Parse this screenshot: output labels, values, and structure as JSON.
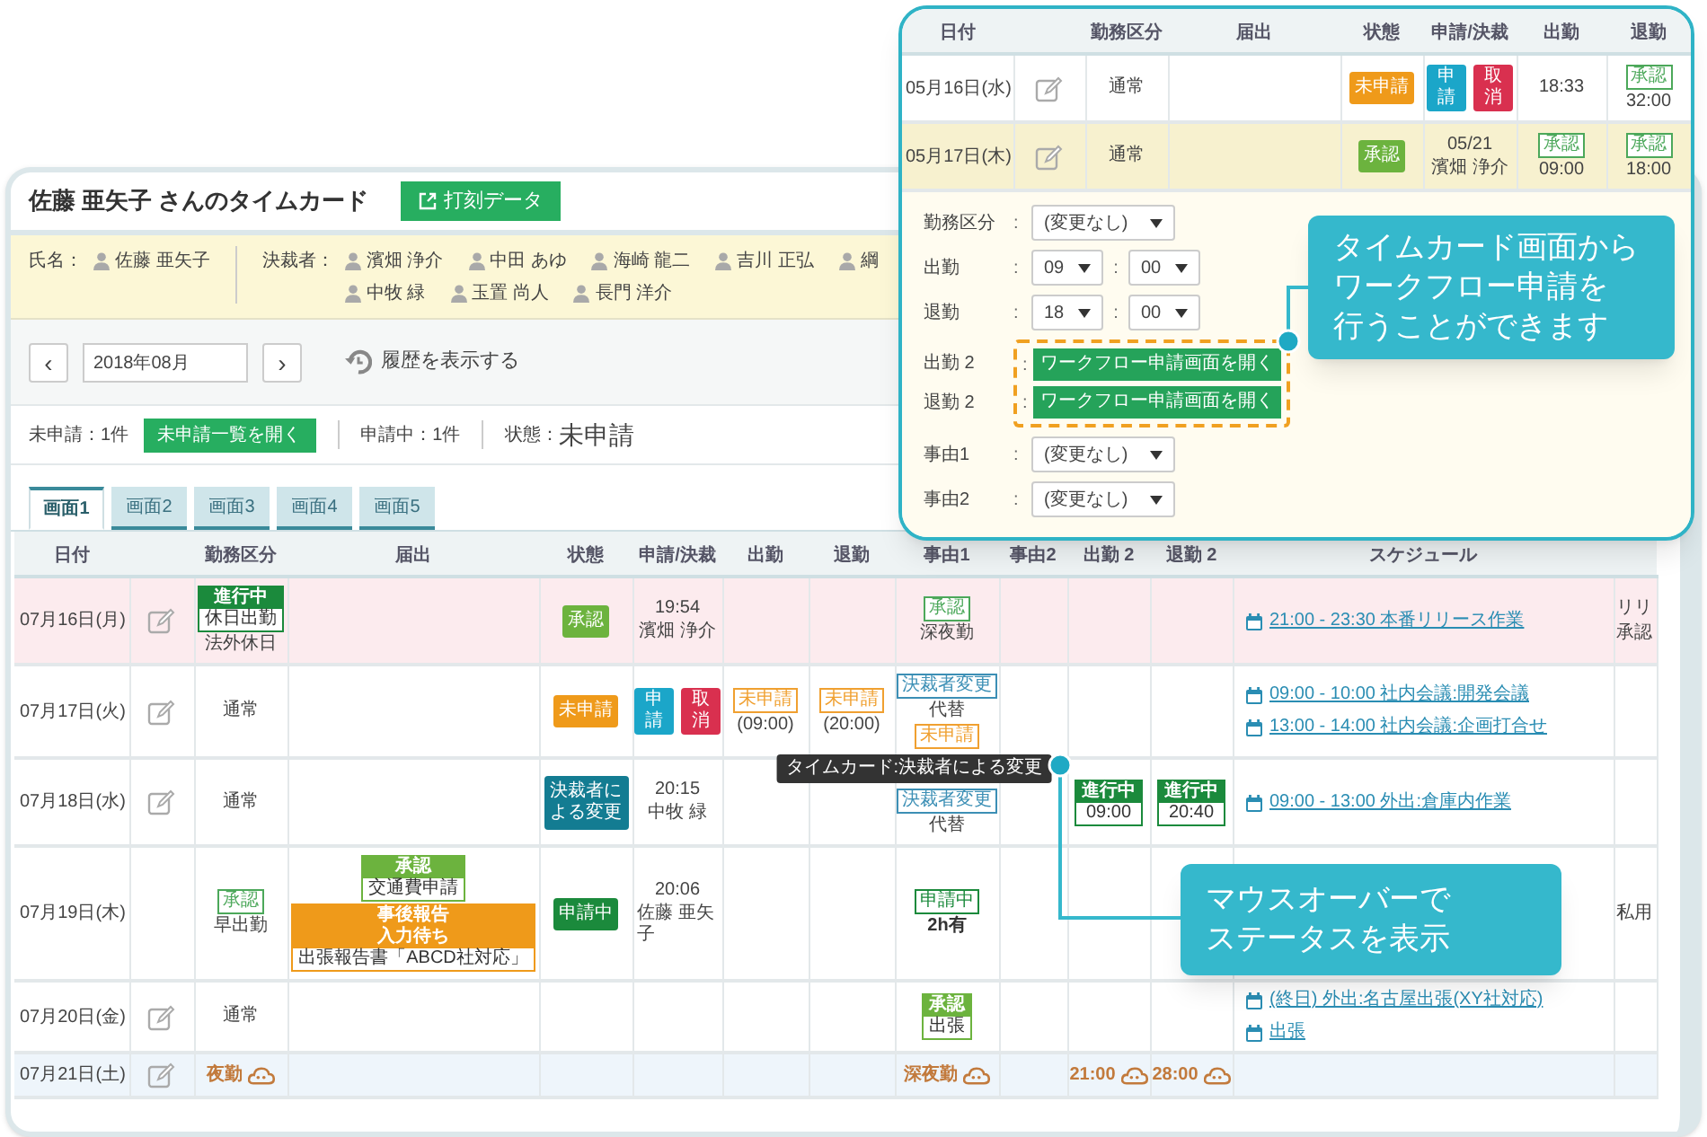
{
  "title": "佐藤 亜矢子 さんのタイムカード",
  "export_button": "打刻データ",
  "person": {
    "label": "氏名：",
    "name": "佐藤 亜矢子"
  },
  "approvers": {
    "label": "決裁者：",
    "names": [
      "濱畑 浄介",
      "中田 あゆ",
      "海崎 龍二",
      "吉川 正弘",
      "綱",
      "中牧 緑",
      "玉置 尚人",
      "長門 洋介"
    ]
  },
  "month_nav": {
    "prev": "‹",
    "value": "2018年08月",
    "next": "›",
    "history": "履歴を表示する"
  },
  "summary": {
    "unsubmitted": "未申請：1件",
    "open_list_button": "未申請一覧を開く",
    "pending": "申請中：1件",
    "state_label": "状態：",
    "state": "未申請"
  },
  "tabs": [
    {
      "label": "画面1",
      "selected": true
    },
    {
      "label": "画面2",
      "selected": false
    },
    {
      "label": "画面3",
      "selected": false
    },
    {
      "label": "画面4",
      "selected": false
    },
    {
      "label": "画面5",
      "selected": false
    }
  ],
  "table": {
    "columns": [
      "日付",
      "",
      "勤務区分",
      "届出",
      "状態",
      "申請/決裁",
      "出勤",
      "退勤",
      "事由1",
      "事由2",
      "出勤 2",
      "退勤 2",
      "スケジュール",
      ""
    ],
    "rows": [
      {
        "color": "#fcebee",
        "cells": [
          [
            {
              "kind": "date",
              "text": "07月16日(月)"
            }
          ],
          [
            {
              "kind": "edit"
            }
          ],
          [
            {
              "kind": "stack",
              "head": [
                "進行中"
              ],
              "body": "休日出勤",
              "color": "#1b8a3c"
            },
            {
              "kind": "text",
              "text": "法外休日"
            }
          ],
          [],
          [
            {
              "kind": "badge",
              "text": "承認",
              "color": "#6cb33e"
            }
          ],
          [
            {
              "kind": "text",
              "text": "19:54"
            },
            {
              "kind": "text",
              "text": "濱畑 浄介"
            }
          ],
          [],
          [],
          [
            {
              "kind": "tag",
              "text": "承認",
              "color": "#4ca85a"
            },
            {
              "kind": "text",
              "text": "深夜勤"
            }
          ],
          [],
          [],
          [],
          [
            {
              "kind": "link",
              "text": "21:00 - 23:30 本番リリース作業"
            }
          ],
          [
            {
              "kind": "text",
              "text": "リリ"
            },
            {
              "kind": "text",
              "text": "承認"
            }
          ]
        ]
      },
      {
        "color": "#ffffff",
        "cells": [
          [
            {
              "kind": "date",
              "text": "07月17日(火)"
            }
          ],
          [
            {
              "kind": "edit"
            }
          ],
          [
            {
              "kind": "text",
              "text": "通常"
            }
          ],
          [],
          [
            {
              "kind": "badge",
              "text": "未申請",
              "color": "#ef9a1a"
            }
          ],
          [
            {
              "kind": "actions",
              "buttons": [
                {
                  "text": "申請",
                  "color": "#1ba6c9"
                },
                {
                  "text": "取消",
                  "color": "#d9304f"
                }
              ]
            }
          ],
          [
            {
              "kind": "tag",
              "text": "未申請",
              "color": "#f0a030"
            },
            {
              "kind": "text",
              "text": "(09:00)"
            }
          ],
          [
            {
              "kind": "tag",
              "text": "未申請",
              "color": "#f0a030"
            },
            {
              "kind": "text",
              "text": "(20:00)"
            }
          ],
          [
            {
              "kind": "tag",
              "text": "決裁者変更",
              "color": "#3c8fb5"
            },
            {
              "kind": "text",
              "text": "代替"
            },
            {
              "kind": "tag",
              "text": "未申請",
              "color": "#f0a030"
            }
          ],
          [],
          [],
          [],
          [
            {
              "kind": "link",
              "text": "09:00 - 10:00 社内会議:開発会議"
            },
            {
              "kind": "link",
              "text": "13:00 - 14:00 社内会議:企画打合せ"
            }
          ],
          []
        ]
      },
      {
        "color": "#ffffff",
        "cells": [
          [
            {
              "kind": "date",
              "text": "07月18日(水)"
            }
          ],
          [
            {
              "kind": "edit"
            }
          ],
          [
            {
              "kind": "text",
              "text": "通常"
            }
          ],
          [],
          [
            {
              "kind": "badge",
              "text": "決裁者による変更",
              "color": "#137c92"
            }
          ],
          [
            {
              "kind": "text",
              "text": "20:15"
            },
            {
              "kind": "text",
              "text": "中牧 緑"
            }
          ],
          [],
          [],
          [
            {
              "kind": "tag",
              "text": "決裁者変更",
              "color": "#3c8fb5",
              "tooltip": "タイムカード:決裁者による変更"
            },
            {
              "kind": "text",
              "text": "代替"
            }
          ],
          [],
          [
            {
              "kind": "stack",
              "head": [
                "進行中"
              ],
              "body": "09:00",
              "color": "#1b8a3c"
            }
          ],
          [
            {
              "kind": "stack",
              "head": [
                "進行中"
              ],
              "body": "20:40",
              "color": "#1b8a3c"
            }
          ],
          [
            {
              "kind": "link",
              "text": "09:00 - 13:00 外出:倉庫内作業"
            }
          ],
          []
        ]
      },
      {
        "color": "#ffffff",
        "cells": [
          [
            {
              "kind": "date",
              "text": "07月19日(木)"
            }
          ],
          [],
          [
            {
              "kind": "tag",
              "text": "承認",
              "color": "#4ca85a"
            },
            {
              "kind": "text",
              "text": "早出勤"
            }
          ],
          [
            {
              "kind": "stack",
              "head": [
                "承認"
              ],
              "body": "交通費申請",
              "color": "#6cb33e"
            },
            {
              "kind": "stack",
              "head": [
                "事後報告",
                "入力待ち"
              ],
              "body": "出張報告書「ABCD社対応」",
              "color": "#ef9a1a"
            }
          ],
          [
            {
              "kind": "badge",
              "text": "申請中",
              "color": "#1b8a3c"
            }
          ],
          [
            {
              "kind": "text",
              "text": "20:06"
            },
            {
              "kind": "text",
              "text": "佐藤 亜矢子"
            }
          ],
          [],
          [],
          [
            {
              "kind": "tag",
              "text": "申請中",
              "color": "#1b8a3c"
            },
            {
              "kind": "bold",
              "text": "2h有"
            }
          ],
          [],
          [],
          [],
          [],
          [
            {
              "kind": "text",
              "text": "私用"
            }
          ]
        ]
      },
      {
        "color": "#ffffff",
        "cells": [
          [
            {
              "kind": "date",
              "text": "07月20日(金)"
            }
          ],
          [
            {
              "kind": "edit"
            }
          ],
          [
            {
              "kind": "text",
              "text": "通常"
            }
          ],
          [],
          [],
          [],
          [],
          [],
          [
            {
              "kind": "stack",
              "head": [
                "承認"
              ],
              "body": "出張",
              "color": "#6cb33e"
            }
          ],
          [],
          [],
          [],
          [
            {
              "kind": "link",
              "text": "(終日) 外出:名古屋出張(XY社対応)"
            },
            {
              "kind": "link",
              "text": "出張"
            }
          ],
          []
        ]
      },
      {
        "color": "#eef5fb",
        "cells": [
          [
            {
              "kind": "date",
              "text": "07月21日(土)"
            }
          ],
          [
            {
              "kind": "edit"
            }
          ],
          [
            {
              "kind": "night",
              "text": "夜勤"
            }
          ],
          [],
          [],
          [],
          [],
          [],
          [
            {
              "kind": "night",
              "text": "深夜勤"
            }
          ],
          [],
          [
            {
              "kind": "night",
              "text": "21:00"
            }
          ],
          [
            {
              "kind": "night",
              "text": "28:00"
            }
          ],
          [],
          []
        ]
      }
    ]
  },
  "popup": {
    "columns": [
      "日付",
      "",
      "勤務区分",
      "届出",
      "状態",
      "申請/決裁",
      "出勤",
      "退勤"
    ],
    "rows": [
      {
        "selected": false,
        "cells": [
          [
            {
              "kind": "date",
              "text": "05月16日(水)"
            }
          ],
          [
            {
              "kind": "edit"
            }
          ],
          [
            {
              "kind": "text",
              "text": "通常"
            }
          ],
          [],
          [
            {
              "kind": "badge",
              "text": "未申請",
              "color": "#ef9a1a"
            }
          ],
          [
            {
              "kind": "actions",
              "buttons": [
                {
                  "text": "申請",
                  "color": "#1ba6c9"
                },
                {
                  "text": "取消",
                  "color": "#d9304f"
                }
              ]
            }
          ],
          [
            {
              "kind": "text",
              "text": "18:33"
            }
          ],
          [
            {
              "kind": "tag",
              "text": "承認",
              "color": "#4ca85a"
            },
            {
              "kind": "text",
              "text": "32:00"
            }
          ]
        ]
      },
      {
        "selected": true,
        "cells": [
          [
            {
              "kind": "date",
              "text": "05月17日(木)"
            }
          ],
          [
            {
              "kind": "edit"
            }
          ],
          [
            {
              "kind": "text",
              "text": "通常"
            }
          ],
          [],
          [
            {
              "kind": "badge",
              "text": "承認",
              "color": "#6cb33e"
            }
          ],
          [
            {
              "kind": "text",
              "text": "05/21"
            },
            {
              "kind": "text",
              "text": "濱畑 浄介"
            }
          ],
          [
            {
              "kind": "tag",
              "text": "承認",
              "color": "#4ca85a"
            },
            {
              "kind": "text",
              "text": "09:00"
            }
          ],
          [
            {
              "kind": "tag",
              "text": "承認",
              "color": "#4ca85a"
            },
            {
              "kind": "text",
              "text": "18:00"
            }
          ]
        ]
      }
    ],
    "form": [
      {
        "kind": "select",
        "label": "勤務区分",
        "sep": ":",
        "value": "(変更なし)"
      },
      {
        "kind": "time",
        "label": "出勤",
        "sep": ":",
        "hour": "09",
        "time_sep": ":",
        "minute": "00"
      },
      {
        "kind": "time",
        "label": "退勤",
        "sep": ":",
        "hour": "18",
        "time_sep": ":",
        "minute": "00"
      },
      {
        "kind": "workflow",
        "label": "出勤 2",
        "sep": ":",
        "button": "ワークフロー申請画面を開く"
      },
      {
        "kind": "workflow",
        "label": "退勤 2",
        "sep": ":",
        "button": "ワークフロー申請画面を開く"
      },
      {
        "kind": "select",
        "label": "事由1",
        "sep": ":",
        "value": "(変更なし)"
      },
      {
        "kind": "select",
        "label": "事由2",
        "sep": ":",
        "value": "(変更なし)"
      }
    ]
  },
  "callouts": [
    {
      "lines": [
        "タイムカード画面から",
        "ワークフロー申請を",
        "行うことができます"
      ]
    },
    {
      "lines": [
        "マウスオーバーで",
        "ステータスを表示"
      ]
    }
  ]
}
